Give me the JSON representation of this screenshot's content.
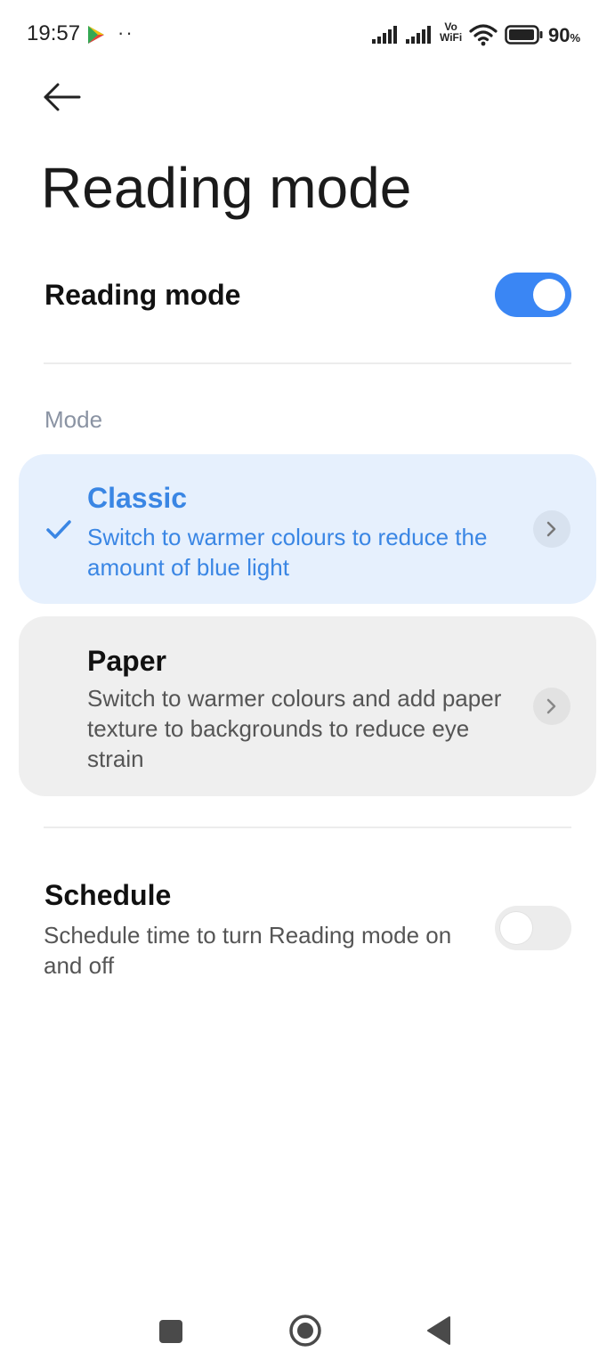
{
  "status_bar": {
    "time": "19:57",
    "notification_dots": "··",
    "vowifi_top": "Vo",
    "vowifi_bottom": "WiFi",
    "battery_percent": "90",
    "battery_percent_sign": "%",
    "icons": [
      "play-store-icon",
      "signal-icon",
      "signal-icon",
      "vowifi-icon",
      "wifi-icon",
      "battery-icon"
    ]
  },
  "header": {
    "back_icon": "arrow-left-icon",
    "title": "Reading mode"
  },
  "reading_mode": {
    "label": "Reading mode",
    "enabled": true
  },
  "mode_section": {
    "label": "Mode",
    "options": [
      {
        "title": "Classic",
        "description": "Switch to warmer colours to reduce the amount of blue light",
        "selected": true
      },
      {
        "title": "Paper",
        "description": "Switch to warmer colours and add paper texture to backgrounds to reduce eye strain",
        "selected": false
      }
    ]
  },
  "schedule": {
    "label": "Schedule",
    "description": "Schedule time to turn Reading mode on and off",
    "enabled": false
  },
  "nav_bar": {
    "icons": [
      "recent-apps-icon",
      "home-icon",
      "back-icon"
    ]
  },
  "colors": {
    "accent": "#3a86f4",
    "selected_card_bg": "#e6f0fd",
    "unselected_card_bg": "#efefef"
  }
}
